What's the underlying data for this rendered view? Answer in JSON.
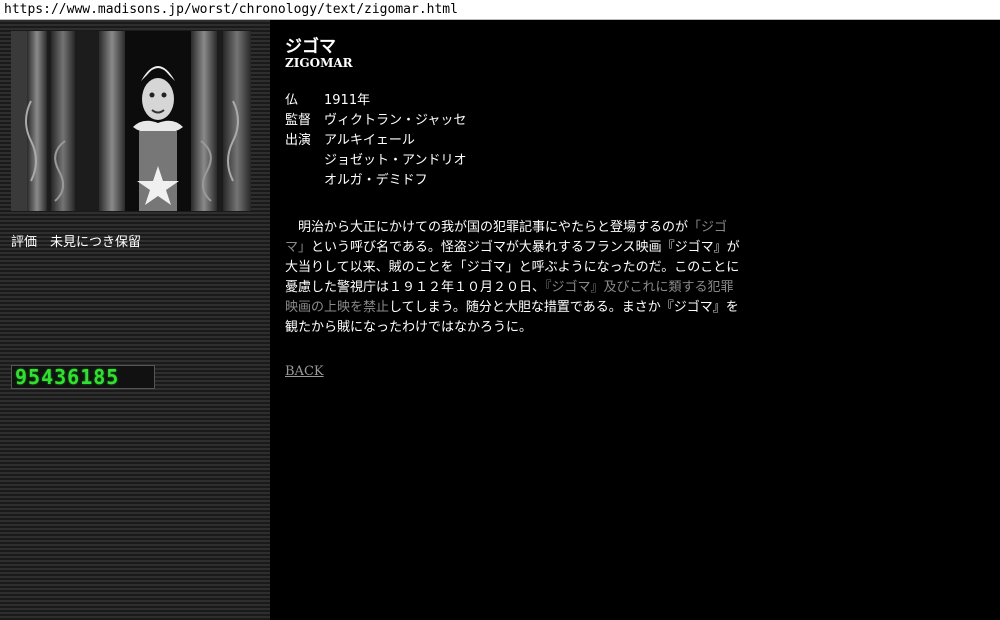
{
  "browser": {
    "url": "https://www.madisons.jp/worst/chronology/text/zigomar.html"
  },
  "sidebar": {
    "rating_label": "評価",
    "rating_value": "未見につき保留",
    "counter": "95436185"
  },
  "movie": {
    "title": "ジゴマ",
    "title_en": "ZIGOMAR",
    "country": "仏",
    "year": "1911年",
    "director_label": "監督",
    "director": "ヴィクトラン・ジャッセ",
    "cast_label": "出演",
    "cast": [
      "アルキイェール",
      "ジョゼット・アンドリオ",
      "オルガ・デミドフ"
    ]
  },
  "body": {
    "p1": "明治から大正にかけての我が国の犯罪記事にやたらと登場するのが",
    "hl1": "「ジゴマ」",
    "p2": "という呼び名である。怪盗ジゴマが大暴れするフランス映画『ジゴマ』が大当りして以来、賊のことを「ジゴマ」と呼ぶようになったのだ。このことに憂慮した警視庁は１９１２年１０月２０日、",
    "hl2": "『ジゴマ』及びこれに類する犯罪映画の上映を禁止",
    "p3": "してしまう。随分と大胆な措置である。まさか『ジゴマ』を観たから賊になったわけではなかろうに。"
  },
  "nav": {
    "back_label": "BACK"
  }
}
